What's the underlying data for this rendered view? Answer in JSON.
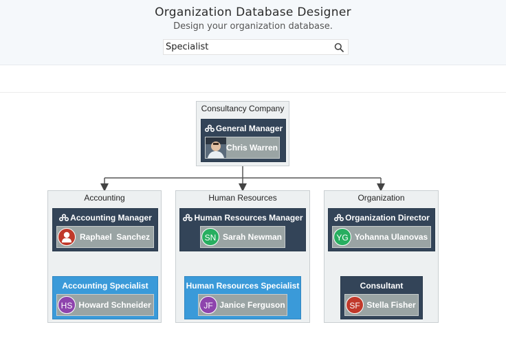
{
  "header": {
    "title": "Organization Database Designer",
    "subtitle": "Design your organization database."
  },
  "search": {
    "value": "Specialist",
    "icon": "search-icon"
  },
  "groups": {
    "company": {
      "label": "Consultancy Company"
    },
    "accounting": {
      "label": "Accounting"
    },
    "hr": {
      "label": "Human Resources"
    },
    "org": {
      "label": "Organization"
    }
  },
  "nodes": {
    "gm": {
      "title": "General Manager",
      "name": "Chris Warren"
    },
    "am": {
      "title": "Accounting Manager",
      "name": "Raphael  Sanchez"
    },
    "as": {
      "title": "Accounting Specialist",
      "name": "Howard Schneider",
      "initials": "HS"
    },
    "hrm": {
      "title": "Human Resources Manager",
      "name": "Sarah Newman",
      "initials": "SN"
    },
    "hrs": {
      "title": "Human Resources Specialist",
      "name": "Janice Ferguson",
      "initials": "JF"
    },
    "od": {
      "title": "Organization Director",
      "name": "Yohanna Ulanovas",
      "initials": "YG"
    },
    "co": {
      "title": "Consultant",
      "name": "Stella Fisher",
      "initials": "SF"
    }
  },
  "colors": {
    "manager_node": "#334458",
    "specialist_node": "#3a9ad9",
    "avatar_green": "#27ae60",
    "avatar_purple": "#8e44ad",
    "avatar_red": "#c0392b"
  }
}
